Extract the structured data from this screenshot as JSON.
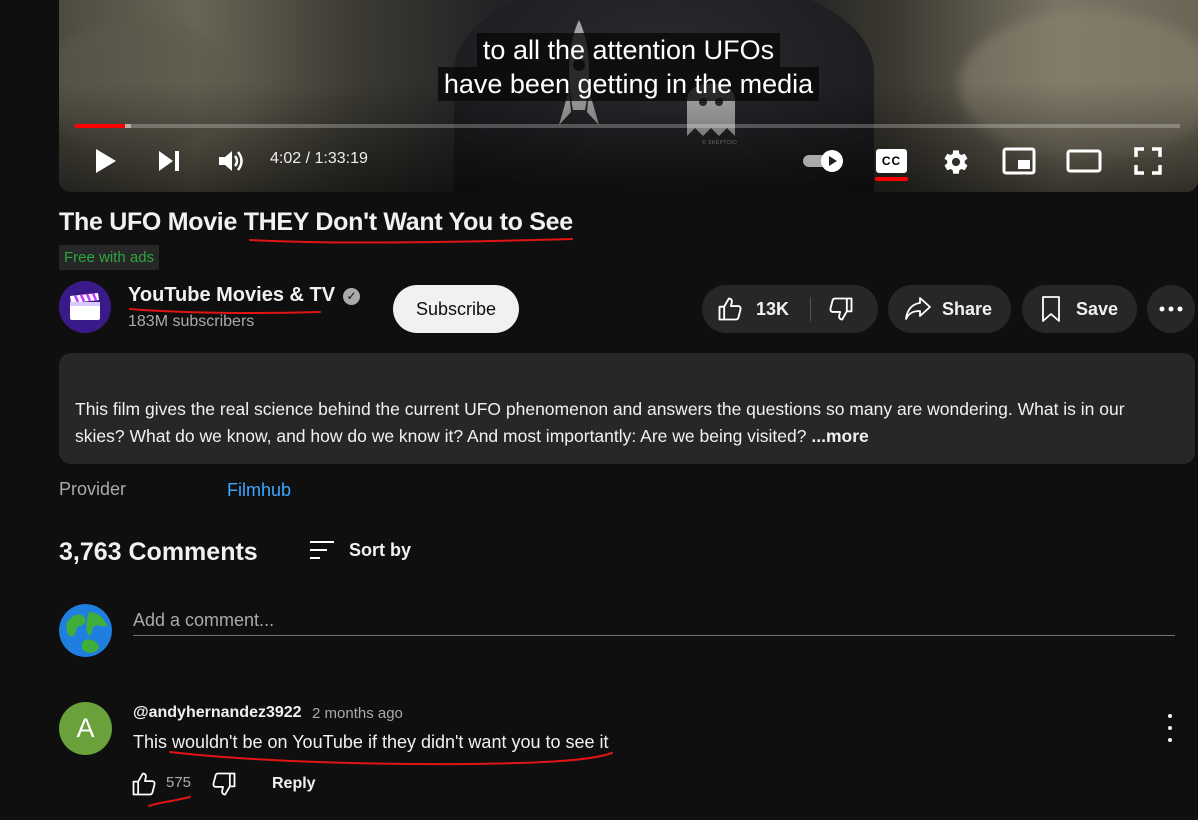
{
  "player": {
    "caption_line1": "to all the attention UFOs",
    "caption_line2": "have been getting in the media",
    "time": "4:02 / 1:33:19",
    "progress": 0.045,
    "buffered": 0.051,
    "cc_label": "CC"
  },
  "video": {
    "title": "The UFO Movie THEY Don't Want You to See",
    "badge": "Free with ads"
  },
  "channel": {
    "name": "YouTube Movies & TV",
    "subscribers": "183M subscribers",
    "subscribe_label": "Subscribe"
  },
  "actions": {
    "likes": "13K",
    "share_label": "Share",
    "save_label": "Save"
  },
  "description": {
    "text": "This film gives the real science behind the current UFO phenomenon and answers the questions so many are wondering. What is in our skies? What do we know, and how do we know it? And most importantly: Are we being visited?",
    "more_label": " ...more"
  },
  "provider": {
    "label": "Provider",
    "value": "Filmhub"
  },
  "comments": {
    "count_label": "3,763 Comments",
    "sort_label": "Sort by",
    "add_placeholder": "Add a comment...",
    "items": [
      {
        "avatar_letter": "A",
        "author": "@andyhernandez3922",
        "time": "2 months ago",
        "text": "This wouldn't be on YouTube if they didn't want you to see it",
        "likes": "575",
        "reply_label": "Reply"
      }
    ]
  },
  "colors": {
    "accent_red": "#ff0000",
    "link_blue": "#3ea6ff",
    "badge_green": "#2ba640",
    "annotation_red": "#e01414"
  }
}
